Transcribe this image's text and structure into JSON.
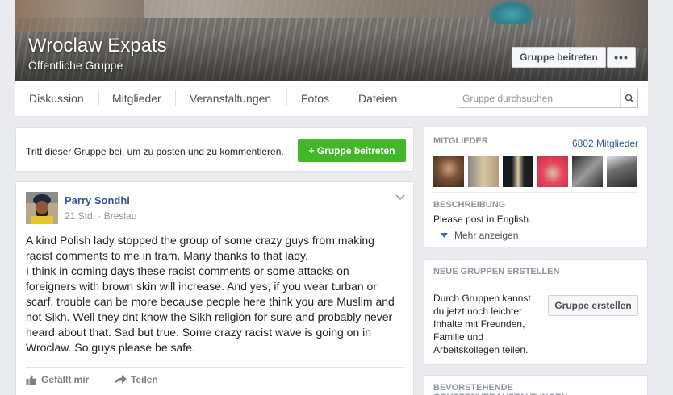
{
  "group": {
    "name": "Wroclaw Expats",
    "visibility": "Öffentliche Gruppe",
    "join_label": "Gruppe beitreten",
    "more_label": "•••"
  },
  "nav": {
    "tabs": [
      "Diskussion",
      "Mitglieder",
      "Veranstaltungen",
      "Fotos",
      "Dateien"
    ],
    "search_placeholder": "Gruppe durchsuchen"
  },
  "invite": {
    "text": "Tritt dieser Gruppe bei, um zu posten und zu kommentieren.",
    "button_label": "+ Gruppe beitreten"
  },
  "post": {
    "author": "Parry Sondhi",
    "time": "21 Std.",
    "location": "Breslau",
    "body": "A kind Polish lady stopped the group of some crazy guys from making racist comments to me in tram. Many thanks to that lady.\nI think in coming days these racist comments or some attacks on foreigners with brown skin will increase. And yes, if you wear turban or scarf, trouble can be more because people here think you are Muslim and not Sikh. Well they dnt know the Sikh religion for sure and probably never heard about that. Sad but true. Some crazy racist wave is going on in Wroclaw. So guys please be safe.",
    "like_label": "Gefällt mir",
    "share_label": "Teilen"
  },
  "sidebar": {
    "members_title": "MITGLIEDER",
    "members_count": "6802 Mitglieder",
    "description_title": "BESCHREIBUNG",
    "description": "Please post in English.",
    "show_more": "Mehr anzeigen",
    "create_title": "NEUE GRUPPEN ERSTELLEN",
    "create_text": "Durch Gruppen kannst du jetzt noch leichter Inhalte mit Freunden, Familie und Arbeitskollegen teilen.",
    "create_button": "Gruppe erstellen",
    "events_title": "BEVORSTEHENDE GRUPPENVERANSTALTUNGEN"
  },
  "colors": {
    "link": "#365899",
    "green": "#42b72a",
    "background": "#e9ebee"
  }
}
